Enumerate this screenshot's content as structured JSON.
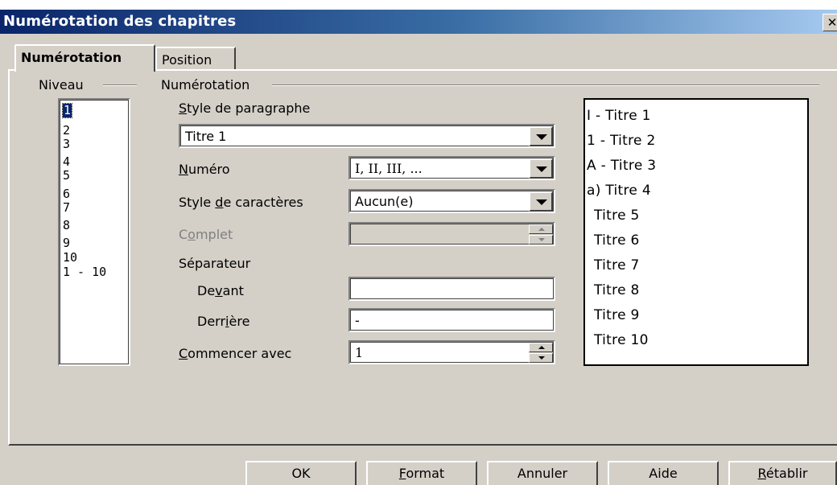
{
  "window": {
    "title": "Numérotation des chapitres",
    "close_glyph": "✕"
  },
  "tabs": [
    {
      "label": "Numérotation",
      "active": true
    },
    {
      "label": "Position",
      "active": false
    }
  ],
  "level_group": {
    "label": "Niveau",
    "items": [
      "1",
      "2",
      "3",
      "4",
      "5",
      "6",
      "7",
      "8",
      "9",
      "10",
      "1 - 10"
    ],
    "selected": "1"
  },
  "numbering_group": {
    "label": "Numérotation",
    "paragraph_style": {
      "label_pre": "",
      "label_u": "S",
      "label_post": "tyle de paragraphe",
      "value": "Titre 1"
    },
    "number": {
      "label_pre": "",
      "label_u": "N",
      "label_post": "uméro",
      "value": "I, II, III, ..."
    },
    "char_style": {
      "label_pre": "Style ",
      "label_u": "d",
      "label_post": "e caractères",
      "value": "Aucun(e)"
    },
    "complete": {
      "label_pre": "C",
      "label_u": "o",
      "label_post": "mplet",
      "value": ""
    },
    "separator_label": "Séparateur",
    "before": {
      "label_pre": "De",
      "label_u": "v",
      "label_post": "ant",
      "value": ""
    },
    "after": {
      "label_pre": "Derr",
      "label_u": "i",
      "label_post": "ère",
      "value": "-"
    },
    "start_with": {
      "label_pre": "",
      "label_u": "C",
      "label_post": "ommencer avec",
      "value": "1"
    }
  },
  "preview": [
    "I -  Titre 1",
    "1 -  Titre 2",
    "A -  Titre 3",
    "a)  Titre 4",
    "Titre 5",
    "Titre 6",
    "Titre 7",
    "Titre 8",
    "Titre 9",
    "Titre 10"
  ],
  "buttons": {
    "ok": {
      "pre": "OK",
      "u": "",
      "post": ""
    },
    "format": {
      "pre": "",
      "u": "F",
      "post": "ormat"
    },
    "cancel": {
      "pre": "Annuler",
      "u": "",
      "post": ""
    },
    "help": {
      "pre": "Aide",
      "u": "",
      "post": ""
    },
    "reset": {
      "pre": "",
      "u": "R",
      "post": "établir"
    }
  },
  "colors": {
    "titlebar_start": "#0a246a",
    "titlebar_end": "#a6caf0",
    "face": "#d4d0c8",
    "selection": "#0a246a"
  }
}
